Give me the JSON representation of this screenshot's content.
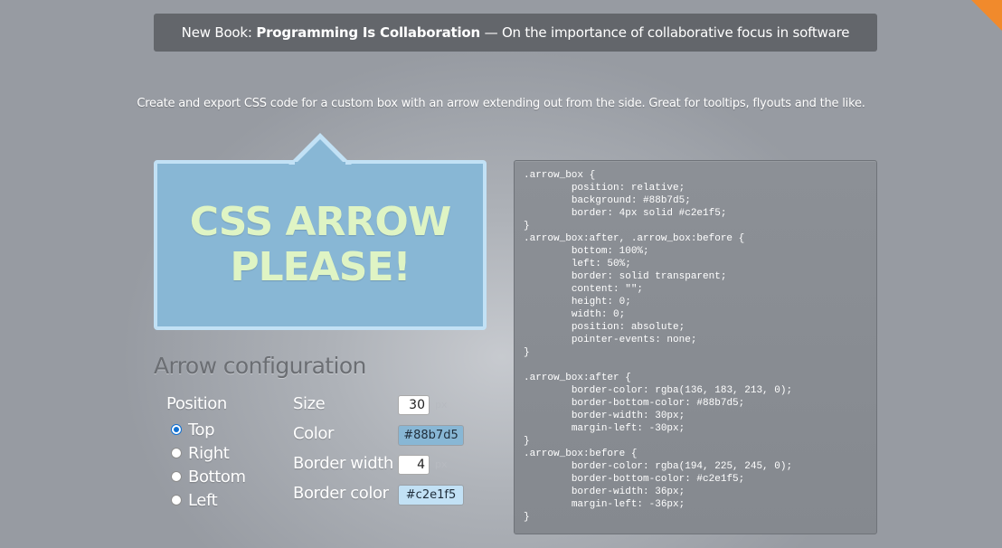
{
  "banner": {
    "prefix": "New Book: ",
    "book_title": "Programming Is Collaboration",
    "suffix": " — On the importance of collaborative focus in software"
  },
  "intro": "Create and export CSS code for a custom box with an arrow extending out from the side. Great for tooltips, flyouts and the like.",
  "preview": {
    "text": "CSS ARROW PLEASE!",
    "background_color": "#88b7d5",
    "border_color": "#c2e1f5",
    "text_color": "#dff4c4"
  },
  "config": {
    "title": "Arrow configuration",
    "position_label": "Position",
    "positions": [
      {
        "label": "Top",
        "checked": true
      },
      {
        "label": "Right",
        "checked": false
      },
      {
        "label": "Bottom",
        "checked": false
      },
      {
        "label": "Left",
        "checked": false
      }
    ],
    "size_label": "Size",
    "size_value": "30",
    "size_unit": "px",
    "color_label": "Color",
    "color_value": "#88b7d5",
    "border_width_label": "Border width",
    "border_width_value": "4",
    "border_width_unit": "px",
    "border_color_label": "Border color",
    "border_color_value": "#c2e1f5"
  },
  "code": ".arrow_box {\n\tposition: relative;\n\tbackground: #88b7d5;\n\tborder: 4px solid #c2e1f5;\n}\n.arrow_box:after, .arrow_box:before {\n\tbottom: 100%;\n\tleft: 50%;\n\tborder: solid transparent;\n\tcontent: \"\";\n\theight: 0;\n\twidth: 0;\n\tposition: absolute;\n\tpointer-events: none;\n}\n\n.arrow_box:after {\n\tborder-color: rgba(136, 183, 213, 0);\n\tborder-bottom-color: #88b7d5;\n\tborder-width: 30px;\n\tmargin-left: -30px;\n}\n.arrow_box:before {\n\tborder-color: rgba(194, 225, 245, 0);\n\tborder-bottom-color: #c2e1f5;\n\tborder-width: 36px;\n\tmargin-left: -36px;\n}",
  "colors": {
    "banner_bg": "#63666b",
    "corner_ribbon": "#f18a2c",
    "code_panel_bg": "#8c9096"
  }
}
